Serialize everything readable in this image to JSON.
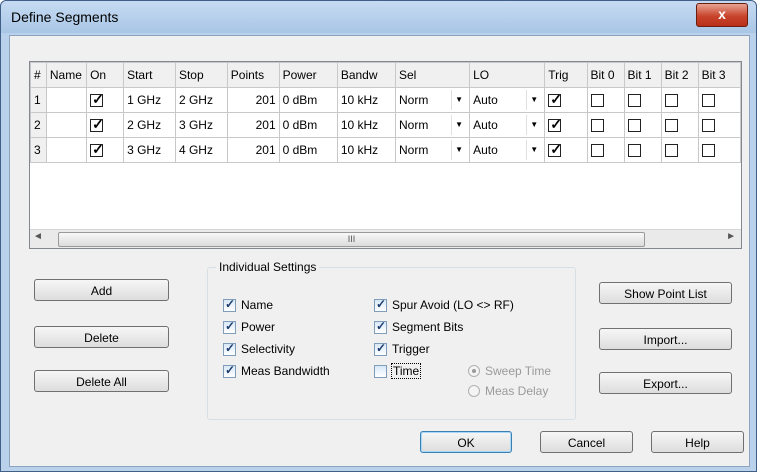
{
  "window": {
    "title": "Define Segments",
    "close_glyph": "x"
  },
  "table": {
    "columns": [
      "#",
      "Name",
      "On",
      "Start",
      "Stop",
      "Points",
      "Power",
      "Bandw",
      "Sel",
      "LO",
      "Trig",
      "Bit 0",
      "Bit 1",
      "Bit 2",
      "Bit 3"
    ],
    "rows": [
      {
        "num": "1",
        "name": "",
        "on": true,
        "start": "1 GHz",
        "stop": "2 GHz",
        "points": "201",
        "power": "0 dBm",
        "bandw": "10 kHz",
        "sel": "Norm",
        "lo": "Auto",
        "trig": true,
        "bits": [
          false,
          false,
          false,
          false
        ]
      },
      {
        "num": "2",
        "name": "",
        "on": true,
        "start": "2 GHz",
        "stop": "3 GHz",
        "points": "201",
        "power": "0 dBm",
        "bandw": "10 kHz",
        "sel": "Norm",
        "lo": "Auto",
        "trig": true,
        "bits": [
          false,
          false,
          false,
          false
        ]
      },
      {
        "num": "3",
        "name": "",
        "on": true,
        "start": "3 GHz",
        "stop": "4 GHz",
        "points": "201",
        "power": "0 dBm",
        "bandw": "10 kHz",
        "sel": "Norm",
        "lo": "Auto",
        "trig": true,
        "bits": [
          false,
          false,
          false,
          false
        ]
      }
    ],
    "scroll_thumb_grip": "III"
  },
  "buttons": {
    "add": "Add",
    "delete": "Delete",
    "delete_all": "Delete All",
    "show_point_list": "Show Point List",
    "import": "Import...",
    "export": "Export...",
    "ok": "OK",
    "cancel": "Cancel",
    "help": "Help"
  },
  "individual_settings": {
    "label": "Individual Settings",
    "name": {
      "label": "Name",
      "checked": true
    },
    "power": {
      "label": "Power",
      "checked": true
    },
    "selectivity": {
      "label": "Selectivity",
      "checked": true
    },
    "meas_bandwidth": {
      "label": "Meas Bandwidth",
      "checked": true
    },
    "spur_avoid": {
      "label": "Spur Avoid (LO <> RF)",
      "checked": true
    },
    "segment_bits": {
      "label": "Segment Bits",
      "checked": true
    },
    "trigger": {
      "label": "Trigger",
      "checked": true
    },
    "time": {
      "label": "Time",
      "checked": false
    },
    "sweep_time": {
      "label": "Sweep Time",
      "selected": true
    },
    "meas_delay": {
      "label": "Meas Delay",
      "selected": false
    }
  },
  "colors": {
    "titlebar": "#b9d1ea",
    "close": "#c8442b",
    "dialog_bg": "#f0f0f0",
    "default_button_border": "#3c7fb1"
  }
}
